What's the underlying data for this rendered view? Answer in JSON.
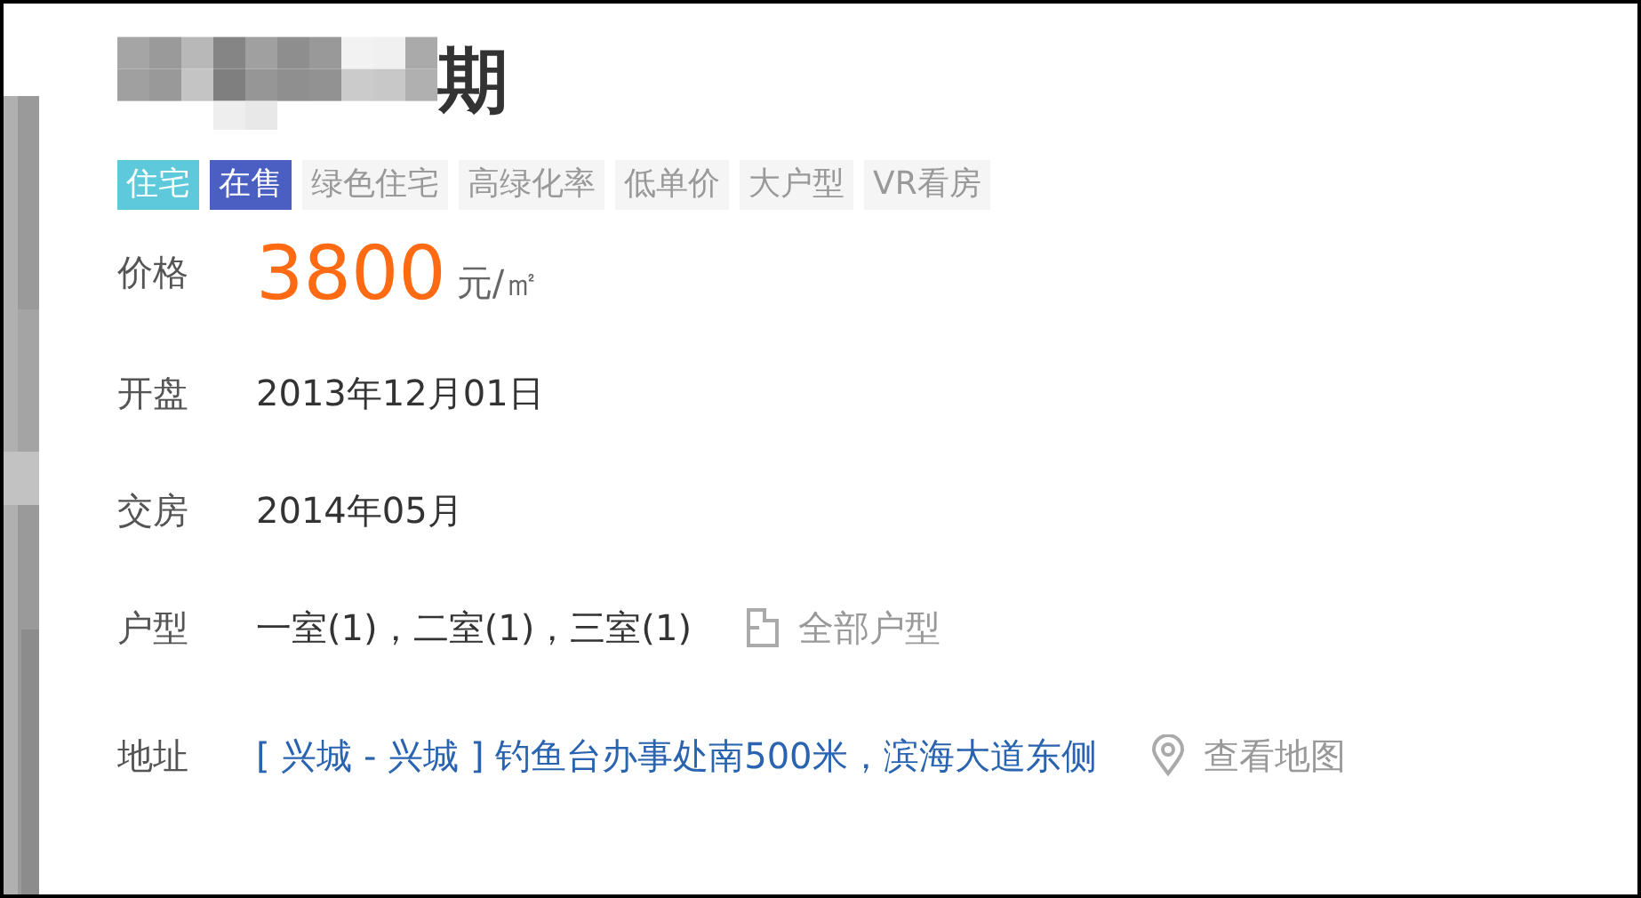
{
  "title": "期",
  "tags": [
    {
      "label": "住宅",
      "color": "#5ec9db"
    },
    {
      "label": "在售",
      "color": "#4a5fc1"
    },
    {
      "label": "绿色住宅",
      "color": "#f5f5f5"
    },
    {
      "label": "高绿化率",
      "color": "#f5f5f5"
    },
    {
      "label": "低单价",
      "color": "#f5f5f5"
    },
    {
      "label": "大户型",
      "color": "#f5f5f5"
    },
    {
      "label": "VR看房",
      "color": "#f5f5f5"
    }
  ],
  "rows": [
    {
      "kind": "price",
      "label": "价格",
      "value": "3800",
      "unit": "元/㎡"
    },
    {
      "kind": "text",
      "label": "开盘",
      "value": "2013年12月01日"
    },
    {
      "kind": "text",
      "label": "交房",
      "value": "2014年05月"
    },
    {
      "kind": "layout",
      "label": "户型",
      "value": "一室(1)，二室(1)，三室(1)",
      "link": "全部户型"
    },
    {
      "kind": "address",
      "label": "地址",
      "value": "[ 兴城 - 兴城 ] 钓鱼台办事处南500米，滨海大道东侧",
      "link": "查看地图"
    }
  ]
}
